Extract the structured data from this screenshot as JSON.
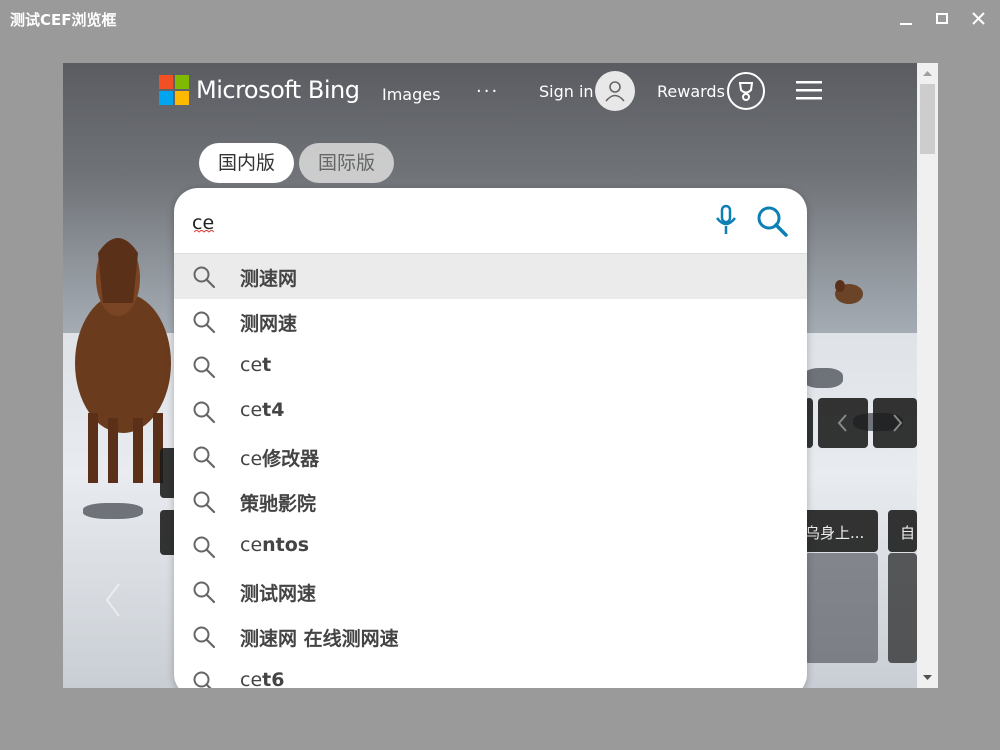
{
  "window": {
    "title": "测试CEF浏览框"
  },
  "header": {
    "brand": "Microsoft Bing",
    "nav_images": "Images",
    "nav_more": "···",
    "sign_in": "Sign in",
    "rewards": "Rewards"
  },
  "tabs": {
    "domestic": "国内版",
    "international": "国际版"
  },
  "search": {
    "value": "ce"
  },
  "suggestions": [
    {
      "typed": "",
      "rest": "测速网"
    },
    {
      "typed": "",
      "rest": "测网速"
    },
    {
      "typed": "ce",
      "rest": "t"
    },
    {
      "typed": "ce",
      "rest": "t4"
    },
    {
      "typed": "ce",
      "rest": "修改器"
    },
    {
      "typed": "",
      "rest": "策驰影院"
    },
    {
      "typed": "ce",
      "rest": "ntos"
    },
    {
      "typed": "",
      "rest": "测试网速"
    },
    {
      "typed": "",
      "rest": "测速网 在线测网速"
    },
    {
      "typed": "ce",
      "rest": "t6"
    }
  ],
  "background_news": {
    "snippet_1": "乌身上...",
    "snippet_2": "自"
  },
  "colors": {
    "accent_blue": "#0c7fb6",
    "ms_red": "#f25022",
    "ms_green": "#7fba00",
    "ms_blue": "#00a4ef",
    "ms_yellow": "#ffb900"
  }
}
